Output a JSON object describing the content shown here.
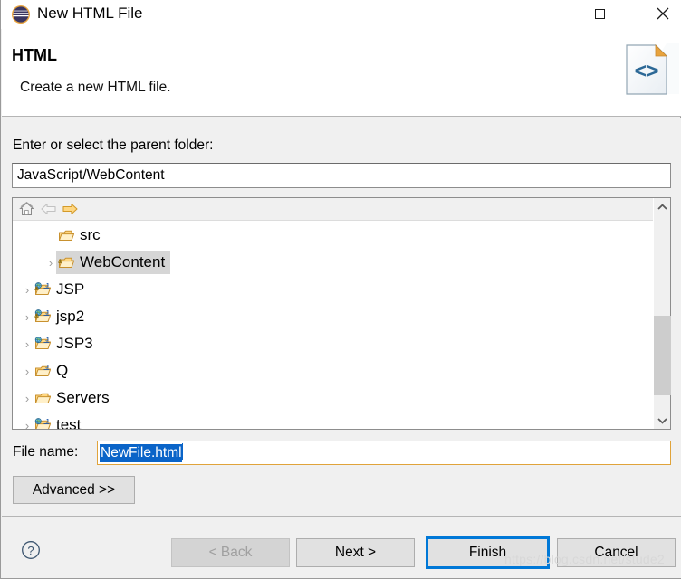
{
  "window": {
    "title": "New HTML File",
    "icon": "eclipse-icon",
    "controls": {
      "minimize": "minimize-icon",
      "maximize": "maximize-icon",
      "close": "close-icon"
    }
  },
  "header": {
    "title": "HTML",
    "description": "Create a new HTML file.",
    "icon": "html-file-icon"
  },
  "form": {
    "parent_label": "Enter or select the parent folder:",
    "parent_value": "JavaScript/WebContent",
    "filename_label": "File name:",
    "filename_value": "NewFile.html",
    "advanced_label": "Advanced >>"
  },
  "tree_toolbar": [
    {
      "name": "home-icon",
      "enabled": true
    },
    {
      "name": "back-arrow-icon",
      "enabled": false
    },
    {
      "name": "forward-arrow-icon",
      "enabled": true
    }
  ],
  "tree": {
    "items": [
      {
        "label": "src",
        "icon": "folder-open-icon",
        "indent": 2,
        "twisty": "",
        "selected": false
      },
      {
        "label": "WebContent",
        "icon": "folder-warning-icon",
        "indent": 2,
        "twisty": "›",
        "selected": true
      },
      {
        "label": "JSP",
        "icon": "web-project-warning-icon",
        "indent": 1,
        "twisty": "›",
        "selected": false
      },
      {
        "label": "jsp2",
        "icon": "web-project-warning-icon",
        "indent": 1,
        "twisty": "›",
        "selected": false
      },
      {
        "label": "JSP3",
        "icon": "web-project-icon",
        "indent": 1,
        "twisty": "›",
        "selected": false
      },
      {
        "label": "Q",
        "icon": "java-project-icon",
        "indent": 1,
        "twisty": "›",
        "selected": false
      },
      {
        "label": "Servers",
        "icon": "folder-open-icon",
        "indent": 1,
        "twisty": "›",
        "selected": false
      },
      {
        "label": "test",
        "icon": "web-project-icon",
        "indent": 1,
        "twisty": "›",
        "selected": false
      }
    ],
    "scrollbar": {
      "up_arrow": "chevron-up-icon",
      "down_arrow": "chevron-down-icon"
    }
  },
  "footer": {
    "help_icon": "help-icon",
    "buttons": [
      {
        "label": "< Back",
        "name": "back-button",
        "enabled": false,
        "default": false
      },
      {
        "label": "Next >",
        "name": "next-button",
        "enabled": true,
        "default": false
      },
      {
        "label": "Finish",
        "name": "finish-button",
        "enabled": true,
        "default": true
      },
      {
        "label": "Cancel",
        "name": "cancel-button",
        "enabled": true,
        "default": false
      }
    ]
  },
  "watermark": "https://blog.csdn.net/stude2",
  "colors": {
    "accent": "#0078d7",
    "selection": "#0a64c8",
    "dialog_bg": "#f0f0f0",
    "tree_selection": "#d6d6d6",
    "folder_gold": "#e0a33a"
  }
}
